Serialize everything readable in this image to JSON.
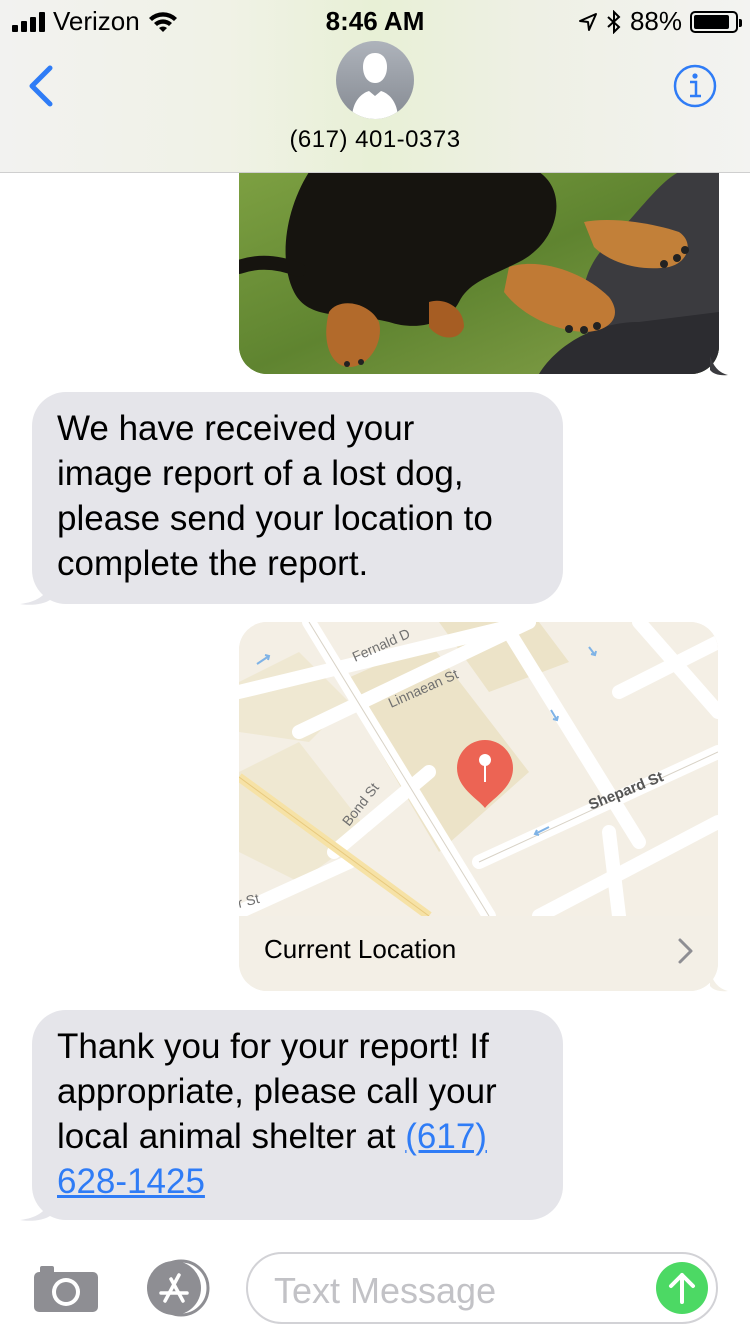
{
  "status_bar": {
    "carrier": "Verizon",
    "time": "8:46 AM",
    "battery_percent": "88%",
    "battery_level": 0.88,
    "icons": [
      "signal-icon",
      "wifi-icon",
      "location-arrow-icon",
      "bluetooth-icon",
      "battery-icon"
    ]
  },
  "header": {
    "contact": "(617) 401-0373",
    "back_icon": "chevron-left-icon",
    "info_icon": "info-icon"
  },
  "messages": [
    {
      "type": "image",
      "direction": "outgoing",
      "content": "photo of black and tan dog on grass"
    },
    {
      "type": "text",
      "direction": "incoming",
      "lines": [
        "We have received your",
        "image report of a lost dog,",
        "please send your location to",
        "complete the report."
      ]
    },
    {
      "type": "location",
      "direction": "outgoing",
      "label": "Current Location",
      "streets": [
        "Fernald D",
        "Linnaean St",
        "Bond St",
        "Shepard St",
        "r St"
      ]
    },
    {
      "type": "text",
      "direction": "incoming",
      "lines": [
        "Thank you for your report! If",
        "appropriate, please call your",
        "local animal shelter at "
      ],
      "phone_part1": "(617)",
      "phone_part2": "628-1425"
    }
  ],
  "input_bar": {
    "placeholder": "Text Message",
    "camera_icon": "camera-icon",
    "apps_icon": "app-store-icon",
    "send_icon": "send-arrow-icon"
  },
  "colors": {
    "accent": "#2f7cf6",
    "incoming_bubble": "#e5e5ea",
    "send_button": "#4cd964",
    "map_pin": "#ec6454"
  }
}
